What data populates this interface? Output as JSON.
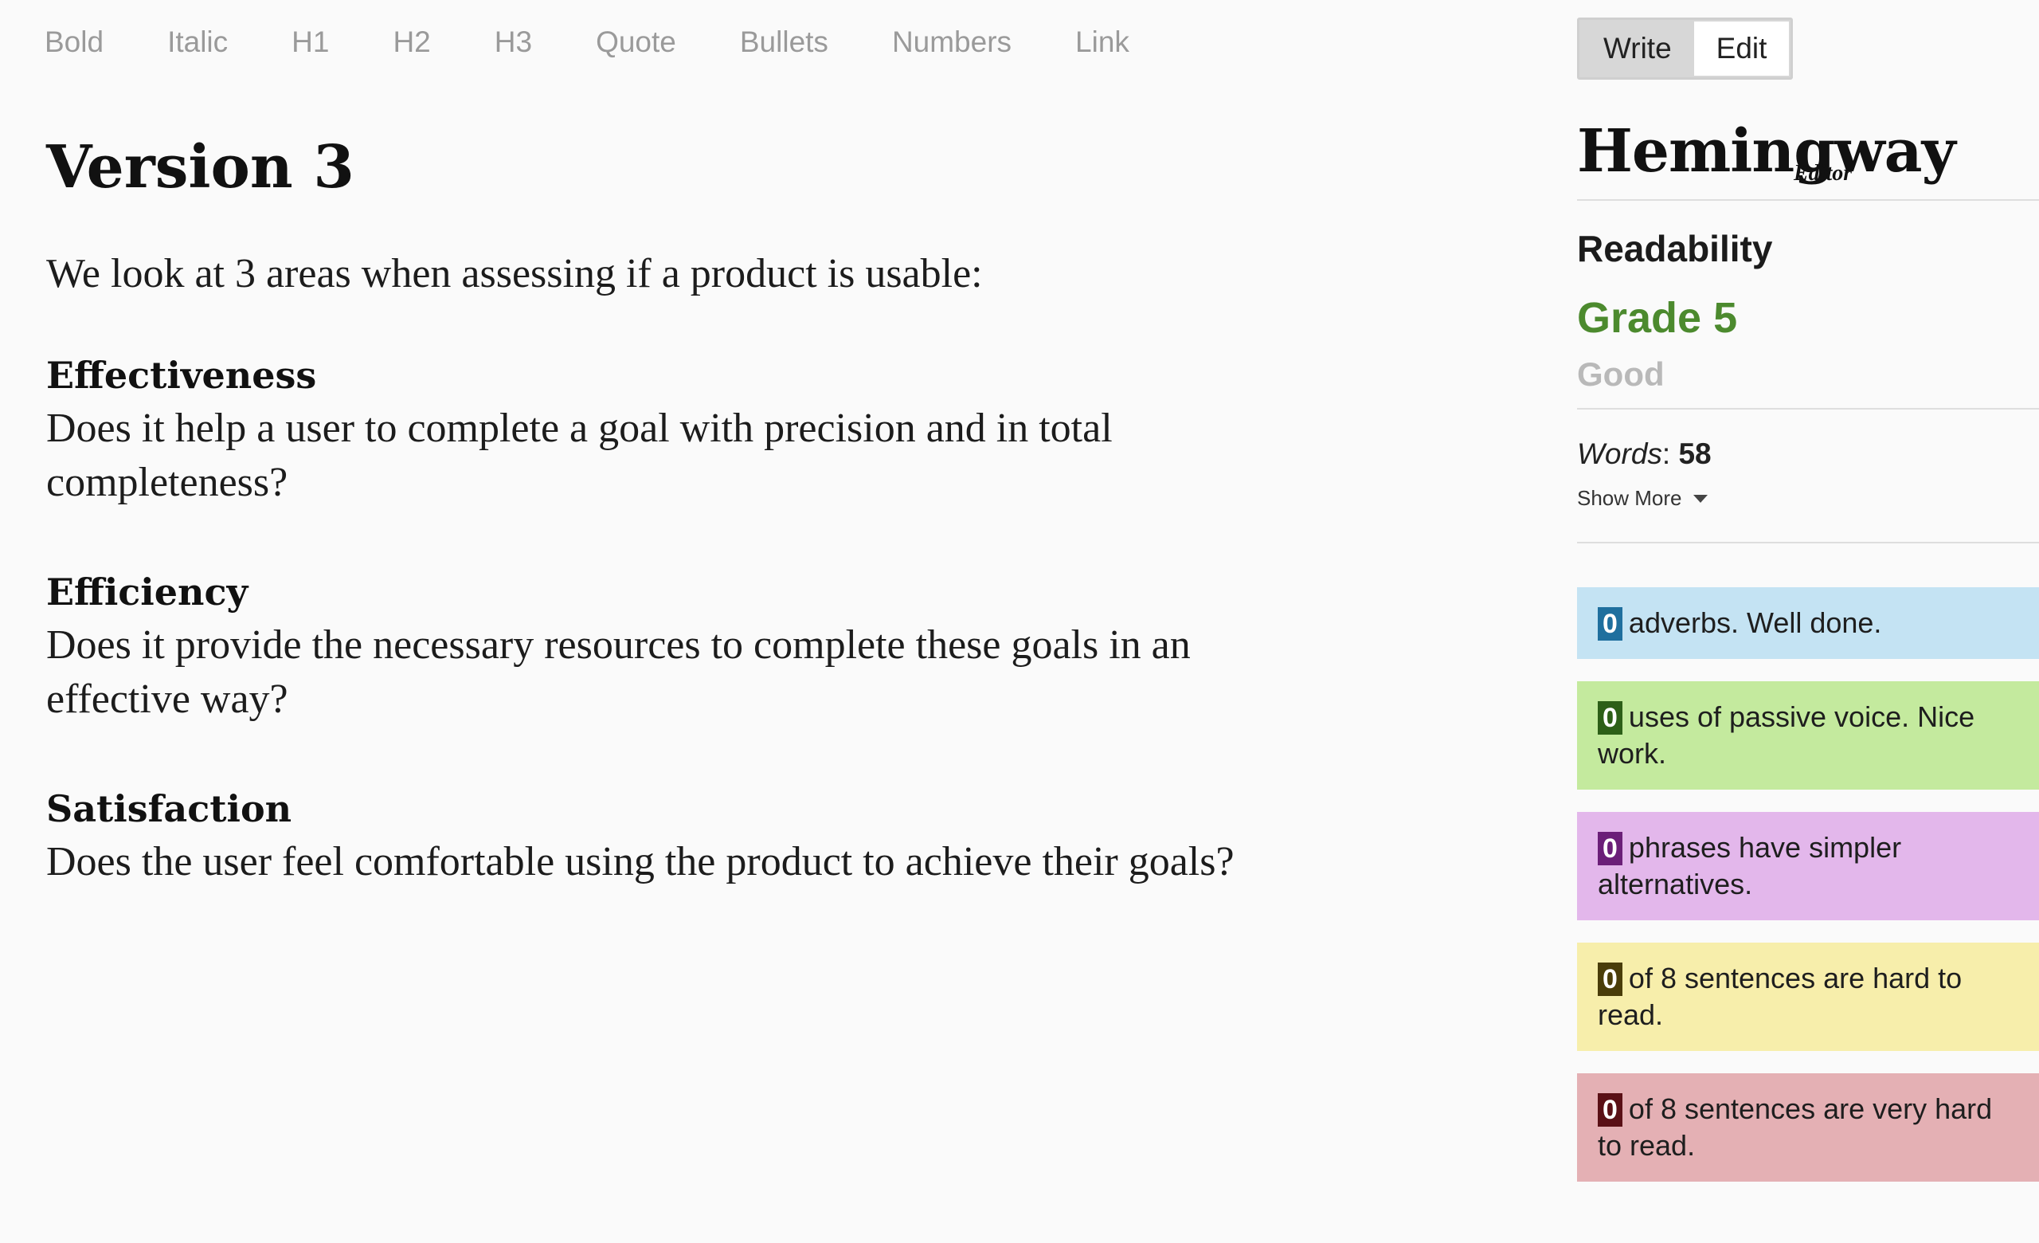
{
  "toolbar": {
    "items": [
      "Bold",
      "Italic",
      "H1",
      "H2",
      "H3",
      "Quote",
      "Bullets",
      "Numbers",
      "Link"
    ]
  },
  "editor": {
    "title": "Version 3",
    "intro": "We look at 3 areas when assessing if a product is usable:",
    "sections": [
      {
        "heading": "Effectiveness",
        "body": "Does it help a user to complete a goal with precision and in total completeness?"
      },
      {
        "heading": "Efficiency",
        "body": "Does it provide the necessary resources to complete these goals in an effective way?"
      },
      {
        "heading": "Satisfaction",
        "body": "Does the user feel comfortable using the product to achieve their goals?"
      }
    ]
  },
  "sidebar": {
    "mode": {
      "write_label": "Write",
      "edit_label": "Edit",
      "active": "Write"
    },
    "logo": {
      "main": "Hemingway",
      "sub": "Editor"
    },
    "readability": {
      "label": "Readability",
      "grade": "Grade 5",
      "description": "Good",
      "grade_color": "#4c8a2e"
    },
    "stats": {
      "words_label": "Words",
      "words_separator": ": ",
      "words_count": "58",
      "show_more_label": "Show More"
    },
    "cards": [
      {
        "count": "0",
        "text": "adverbs. Well done.",
        "bg_color": "#c4e3f3",
        "badge_color": "#1f6f9e"
      },
      {
        "count": "0",
        "text": "uses of passive voice. Nice work.",
        "bg_color": "#c4ea9e",
        "badge_color": "#2d5f18"
      },
      {
        "count": "0",
        "text": "phrases have simpler alternatives.",
        "bg_color": "#e3b7eb",
        "badge_color": "#6b1f78"
      },
      {
        "count": "0",
        "text": "of 8 sentences are hard to read.",
        "bg_color": "#f7eeab",
        "badge_color": "#4a3d0a"
      },
      {
        "count": "0",
        "text": "of 8 sentences are very hard to read.",
        "bg_color": "#e4b0b4",
        "badge_color": "#5a1016"
      }
    ]
  }
}
